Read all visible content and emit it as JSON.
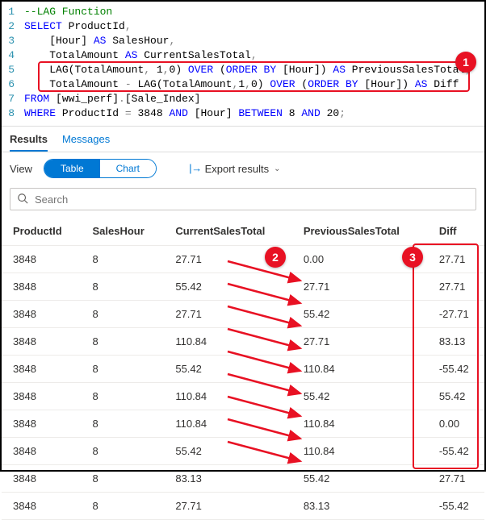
{
  "editor": {
    "lines": [
      {
        "n": "1",
        "seg": [
          {
            "c": "c-comment",
            "t": "--LAG Function"
          }
        ]
      },
      {
        "n": "2",
        "seg": [
          {
            "c": "c-kw",
            "t": "SELECT"
          },
          {
            "c": "c-id",
            "t": " ProductId"
          },
          {
            "c": "c-op",
            "t": ","
          }
        ]
      },
      {
        "n": "3",
        "seg": [
          {
            "c": "c-id",
            "t": "    [Hour] "
          },
          {
            "c": "c-kw",
            "t": "AS"
          },
          {
            "c": "c-id",
            "t": " SalesHour"
          },
          {
            "c": "c-op",
            "t": ","
          }
        ]
      },
      {
        "n": "4",
        "seg": [
          {
            "c": "c-id",
            "t": "    TotalAmount "
          },
          {
            "c": "c-kw",
            "t": "AS"
          },
          {
            "c": "c-id",
            "t": " CurrentSalesTotal"
          },
          {
            "c": "c-op",
            "t": ","
          }
        ]
      },
      {
        "n": "5",
        "seg": [
          {
            "c": "c-id",
            "t": "    "
          },
          {
            "c": "c-func",
            "t": "LAG"
          },
          {
            "c": "c-paren",
            "t": "("
          },
          {
            "c": "c-id",
            "t": "TotalAmount"
          },
          {
            "c": "c-op",
            "t": ", "
          },
          {
            "c": "c-num",
            "t": "1"
          },
          {
            "c": "c-op",
            "t": ","
          },
          {
            "c": "c-num",
            "t": "0"
          },
          {
            "c": "c-paren",
            "t": ") "
          },
          {
            "c": "c-kw",
            "t": "OVER"
          },
          {
            "c": "c-paren",
            "t": " ("
          },
          {
            "c": "c-kw",
            "t": "ORDER BY"
          },
          {
            "c": "c-id",
            "t": " [Hour]"
          },
          {
            "c": "c-paren",
            "t": ") "
          },
          {
            "c": "c-kw",
            "t": "AS"
          },
          {
            "c": "c-id",
            "t": " PreviousSalesTotal"
          },
          {
            "c": "c-op",
            "t": ","
          }
        ]
      },
      {
        "n": "6",
        "seg": [
          {
            "c": "c-id",
            "t": "    TotalAmount "
          },
          {
            "c": "c-op",
            "t": "-"
          },
          {
            "c": "c-id",
            "t": " "
          },
          {
            "c": "c-func",
            "t": "LAG"
          },
          {
            "c": "c-paren",
            "t": "("
          },
          {
            "c": "c-id",
            "t": "TotalAmount"
          },
          {
            "c": "c-op",
            "t": ","
          },
          {
            "c": "c-num",
            "t": "1"
          },
          {
            "c": "c-op",
            "t": ","
          },
          {
            "c": "c-num",
            "t": "0"
          },
          {
            "c": "c-paren",
            "t": ") "
          },
          {
            "c": "c-kw",
            "t": "OVER"
          },
          {
            "c": "c-paren",
            "t": " ("
          },
          {
            "c": "c-kw",
            "t": "ORDER BY"
          },
          {
            "c": "c-id",
            "t": " [Hour]"
          },
          {
            "c": "c-paren",
            "t": ") "
          },
          {
            "c": "c-kw",
            "t": "AS"
          },
          {
            "c": "c-id",
            "t": " Diff"
          }
        ]
      },
      {
        "n": "7",
        "seg": [
          {
            "c": "c-kw",
            "t": "FROM"
          },
          {
            "c": "c-id",
            "t": " [wwi_perf]"
          },
          {
            "c": "c-op",
            "t": "."
          },
          {
            "c": "c-id",
            "t": "[Sale_Index]"
          }
        ]
      },
      {
        "n": "8",
        "seg": [
          {
            "c": "c-kw",
            "t": "WHERE"
          },
          {
            "c": "c-id",
            "t": " ProductId "
          },
          {
            "c": "c-op",
            "t": "="
          },
          {
            "c": "c-id",
            "t": " "
          },
          {
            "c": "c-num",
            "t": "3848"
          },
          {
            "c": "c-id",
            "t": " "
          },
          {
            "c": "c-kw",
            "t": "AND"
          },
          {
            "c": "c-id",
            "t": " [Hour] "
          },
          {
            "c": "c-kw",
            "t": "BETWEEN"
          },
          {
            "c": "c-id",
            "t": " "
          },
          {
            "c": "c-num",
            "t": "8"
          },
          {
            "c": "c-id",
            "t": " "
          },
          {
            "c": "c-kw",
            "t": "AND"
          },
          {
            "c": "c-id",
            "t": " "
          },
          {
            "c": "c-num",
            "t": "20"
          },
          {
            "c": "c-op",
            "t": ";"
          }
        ]
      }
    ]
  },
  "tabs": {
    "results": "Results",
    "messages": "Messages"
  },
  "toolbar": {
    "view_label": "View",
    "table_label": "Table",
    "chart_label": "Chart",
    "export_label": "Export results"
  },
  "search": {
    "placeholder": "Search"
  },
  "columns": [
    "ProductId",
    "SalesHour",
    "CurrentSalesTotal",
    "PreviousSalesTotal",
    "Diff"
  ],
  "rows": [
    {
      "ProductId": "3848",
      "SalesHour": "8",
      "CurrentSalesTotal": "27.71",
      "PreviousSalesTotal": "0.00",
      "Diff": "27.71"
    },
    {
      "ProductId": "3848",
      "SalesHour": "8",
      "CurrentSalesTotal": "55.42",
      "PreviousSalesTotal": "27.71",
      "Diff": "27.71"
    },
    {
      "ProductId": "3848",
      "SalesHour": "8",
      "CurrentSalesTotal": "27.71",
      "PreviousSalesTotal": "55.42",
      "Diff": "-27.71"
    },
    {
      "ProductId": "3848",
      "SalesHour": "8",
      "CurrentSalesTotal": "110.84",
      "PreviousSalesTotal": "27.71",
      "Diff": "83.13"
    },
    {
      "ProductId": "3848",
      "SalesHour": "8",
      "CurrentSalesTotal": "55.42",
      "PreviousSalesTotal": "110.84",
      "Diff": "-55.42"
    },
    {
      "ProductId": "3848",
      "SalesHour": "8",
      "CurrentSalesTotal": "110.84",
      "PreviousSalesTotal": "55.42",
      "Diff": "55.42"
    },
    {
      "ProductId": "3848",
      "SalesHour": "8",
      "CurrentSalesTotal": "110.84",
      "PreviousSalesTotal": "110.84",
      "Diff": "0.00"
    },
    {
      "ProductId": "3848",
      "SalesHour": "8",
      "CurrentSalesTotal": "55.42",
      "PreviousSalesTotal": "110.84",
      "Diff": "-55.42"
    },
    {
      "ProductId": "3848",
      "SalesHour": "8",
      "CurrentSalesTotal": "83.13",
      "PreviousSalesTotal": "55.42",
      "Diff": "27.71"
    },
    {
      "ProductId": "3848",
      "SalesHour": "8",
      "CurrentSalesTotal": "27.71",
      "PreviousSalesTotal": "83.13",
      "Diff": "-55.42"
    }
  ],
  "badges": {
    "b1": "1",
    "b2": "2",
    "b3": "3"
  },
  "chart_data": {
    "type": "table",
    "columns": [
      "ProductId",
      "SalesHour",
      "CurrentSalesTotal",
      "PreviousSalesTotal",
      "Diff"
    ],
    "rows": [
      [
        3848,
        8,
        27.71,
        0.0,
        27.71
      ],
      [
        3848,
        8,
        55.42,
        27.71,
        27.71
      ],
      [
        3848,
        8,
        27.71,
        55.42,
        -27.71
      ],
      [
        3848,
        8,
        110.84,
        27.71,
        83.13
      ],
      [
        3848,
        8,
        55.42,
        110.84,
        -55.42
      ],
      [
        3848,
        8,
        110.84,
        55.42,
        55.42
      ],
      [
        3848,
        8,
        110.84,
        110.84,
        0.0
      ],
      [
        3848,
        8,
        55.42,
        110.84,
        -55.42
      ],
      [
        3848,
        8,
        83.13,
        55.42,
        27.71
      ],
      [
        3848,
        8,
        27.71,
        83.13,
        -55.42
      ]
    ]
  }
}
